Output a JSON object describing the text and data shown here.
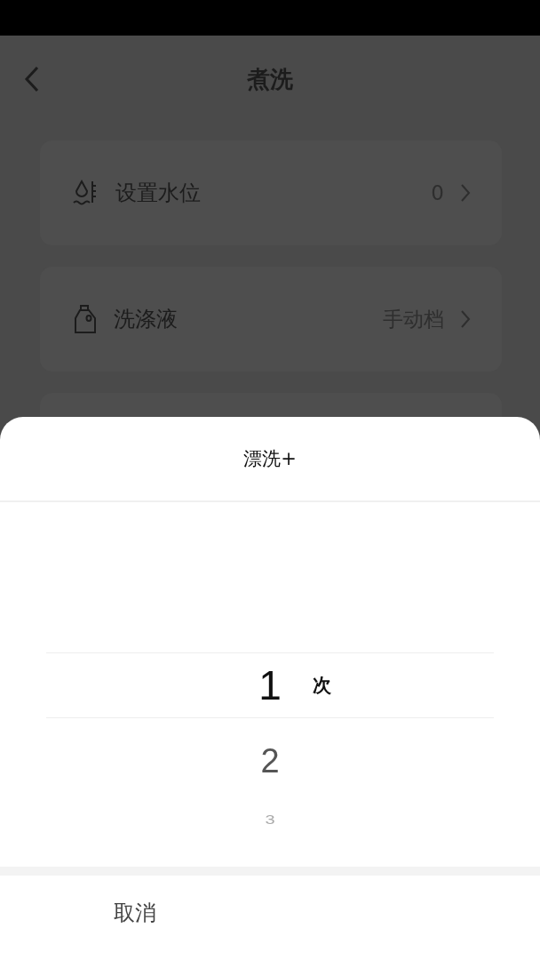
{
  "page": {
    "title": "煮洗"
  },
  "settings": [
    {
      "kind": "water",
      "label": "设置水位",
      "value": "0"
    },
    {
      "kind": "detergent",
      "label": "洗涤液",
      "value": "手动档"
    }
  ],
  "sheet": {
    "title": "漂洗+",
    "unit": "次",
    "options": [
      {
        "label": "1",
        "selected": true
      },
      {
        "label": "2",
        "selected": false
      },
      {
        "label": "3",
        "selected": false
      }
    ],
    "cancel": "取消"
  }
}
